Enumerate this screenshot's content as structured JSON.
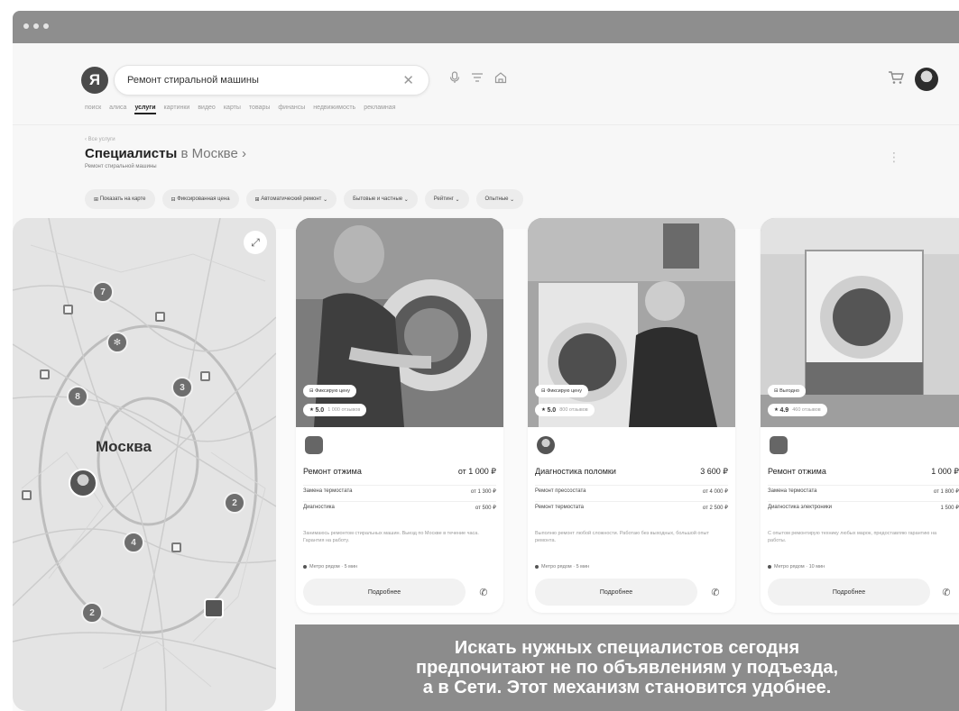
{
  "search": {
    "logo_letter": "Я",
    "query": "Ремонт стиральной машины",
    "clear_icon": "✕",
    "icons": [
      "microphone-icon",
      "filter-icon",
      "home-icon"
    ]
  },
  "tabs": [
    "поиск",
    "алиса",
    "услуги",
    "картинки",
    "видео",
    "карты",
    "товары",
    "финансы",
    "недвижимость",
    "рекламная"
  ],
  "active_tab": 2,
  "breadcrumb": "‹ Все услуги",
  "heading": {
    "title": "Специалисты",
    "city": " в Москве",
    "arrow": " ›"
  },
  "subtitle": "Ремонт стиральной машины",
  "filters": [
    "Показать на карте",
    "Фиксированная цена",
    "Автоматический ремонт",
    "Бытовые и частные",
    "Рейтинг",
    "Опытные"
  ],
  "map": {
    "city_label": "Москва",
    "pins": [
      "7",
      "3",
      "8",
      "3",
      "2",
      "4",
      "2"
    ]
  },
  "cards": [
    {
      "badge_fixed": "Фиксирую цену",
      "rating": "5.0",
      "reviews": "1 000 отзывов",
      "service": "Ремонт отжима",
      "price": "от 1 000 ₽",
      "sub_rows": [
        {
          "label": "Замена термостата",
          "price": "от 1 300 ₽"
        },
        {
          "label": "Диагностика",
          "price": "от 500 ₽"
        }
      ],
      "desc": "Занимаюсь ремонтом стиральных машин. Выезд по Москве в течение часа. Гарантия на работу.",
      "meta": "Метро рядом · 5 мин",
      "more": "Подробнее"
    },
    {
      "badge_fixed": "Фиксирую цену",
      "rating": "5.0",
      "reviews": "800 отзывов",
      "service": "Диагностика поломки",
      "price": "3 600 ₽",
      "sub_rows": [
        {
          "label": "Ремонт прессостата",
          "price": "от 4 000 ₽"
        },
        {
          "label": "Ремонт термостата",
          "price": "от 2 500 ₽"
        }
      ],
      "desc": "Выполню ремонт любой сложности. Работаю без выходных, большой опыт ремонта.",
      "meta": "Метро рядом · 5 мин",
      "more": "Подробнее"
    },
    {
      "badge_fixed": "Выгодно",
      "rating": "4.9",
      "reviews": "460 отзывов",
      "service": "Ремонт отжима",
      "price": "1 000 ₽",
      "sub_rows": [
        {
          "label": "Замена термостата",
          "price": "от 1 800 ₽"
        },
        {
          "label": "Диагностика электроники",
          "price": "1 500 ₽"
        }
      ],
      "desc": "С опытом ремонтирую технику любых марок, предоставляю гарантию на работы.",
      "meta": "Метро рядом · 10 мин",
      "more": "Подробнее"
    }
  ],
  "caption": [
    "Искать нужных специалистов сегодня",
    "предпочитают не по объявлениям у подъезда,",
    "а в Сети. Этот механизм становится удобнее."
  ]
}
